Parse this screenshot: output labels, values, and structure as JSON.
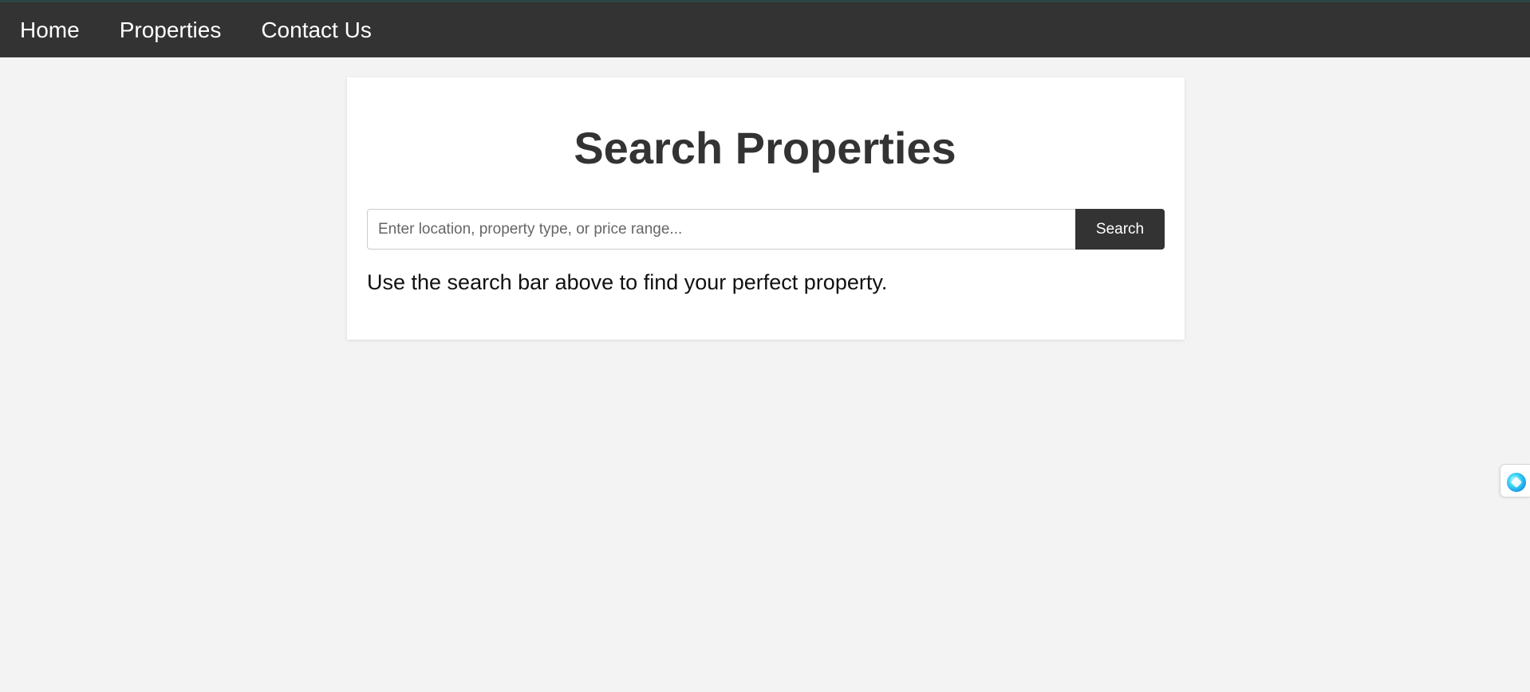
{
  "nav": {
    "items": [
      {
        "label": "Home"
      },
      {
        "label": "Properties"
      },
      {
        "label": "Contact Us"
      }
    ]
  },
  "main": {
    "title": "Search Properties",
    "search": {
      "placeholder": "Enter location, property type, or price range...",
      "value": "",
      "button_label": "Search"
    },
    "helper_text": "Use the search bar above to find your perfect property."
  },
  "widget": {
    "icon": "assistant-orb-icon"
  },
  "colors": {
    "navbar": "#333333",
    "page_background": "#f3f3f3",
    "button": "#333333",
    "title": "#333333"
  }
}
